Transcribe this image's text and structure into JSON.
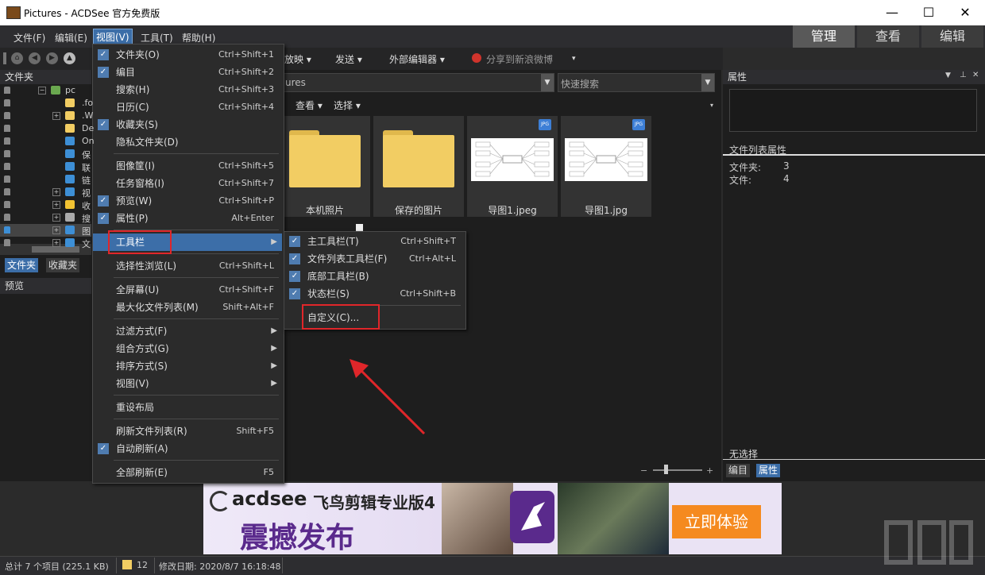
{
  "window": {
    "title": "Pictures - ACDSee 官方免费版",
    "minimize": "—",
    "maximize": "☐",
    "close": "✕"
  },
  "menubar": {
    "items": [
      "文件(F)",
      "编辑(E)",
      "视图(V)",
      "工具(T)",
      "帮助(H)"
    ],
    "modes": [
      "管理",
      "查看",
      "编辑"
    ]
  },
  "toolbar": {
    "items": [
      "放映 ▾",
      "发送 ▾",
      "外部编辑器 ▾",
      "分享到新浪微博",
      "▾"
    ]
  },
  "left_panel": {
    "header": "文件夹",
    "tree": [
      {
        "label": "pc",
        "expander": "−",
        "color": "#6aa84f"
      },
      {
        "label": ".fo",
        "expander": "",
        "color": "#f2cd63"
      },
      {
        "label": ".W",
        "expander": "+",
        "color": "#f2cd63"
      },
      {
        "label": "De",
        "expander": "",
        "color": "#f2cd63"
      },
      {
        "label": "On",
        "expander": "",
        "color": "#3d8fd6"
      },
      {
        "label": "保",
        "expander": "",
        "color": "#3d8fd6"
      },
      {
        "label": "联",
        "expander": "",
        "color": "#3d8fd6"
      },
      {
        "label": "链",
        "expander": "",
        "color": "#3d8fd6"
      },
      {
        "label": "视",
        "expander": "+",
        "color": "#3d8fd6"
      },
      {
        "label": "收",
        "expander": "+",
        "color": "#f1c232"
      },
      {
        "label": "搜",
        "expander": "+",
        "color": "#aaaaaa"
      },
      {
        "label": "图",
        "expander": "+",
        "color": "#3d8fd6"
      },
      {
        "label": "文",
        "expander": "+",
        "color": "#3d8fd6"
      }
    ],
    "tabs": [
      "文件夹",
      "收藏夹"
    ],
    "preview_header": "预览"
  },
  "center": {
    "path_value": "ures",
    "search_placeholder": "快速搜索",
    "view_label": "查看 ▾",
    "select_label": "选择 ▾",
    "tiles": [
      {
        "caption": "本机照片",
        "type": "folder"
      },
      {
        "caption": "保存的图片",
        "type": "folder"
      },
      {
        "caption": "导图1.jpeg",
        "type": "image",
        "badge": "JPG"
      },
      {
        "caption": "导图1.jpg",
        "type": "image",
        "badge": "JPG"
      }
    ]
  },
  "right_panel": {
    "header": "属性",
    "section": "文件列表属性",
    "folders_label": "文件夹:",
    "folders_value": "3",
    "files_label": "文件:",
    "files_value": "4",
    "no_selection": "无选择",
    "tabs": [
      "编目",
      "属性"
    ]
  },
  "view_menu": {
    "items": [
      {
        "label": "文件夹(O)",
        "shortcut": "Ctrl+Shift+1",
        "checked": true
      },
      {
        "label": "编目",
        "shortcut": "Ctrl+Shift+2",
        "checked": true
      },
      {
        "label": "搜索(H)",
        "shortcut": "Ctrl+Shift+3",
        "checked": false
      },
      {
        "label": "日历(C)",
        "shortcut": "Ctrl+Shift+4",
        "checked": false
      },
      {
        "label": "收藏夹(S)",
        "shortcut": "",
        "checked": true
      },
      {
        "label": "隐私文件夹(D)",
        "shortcut": "",
        "checked": false
      },
      {
        "label": "图像筐(I)",
        "shortcut": "Ctrl+Shift+5",
        "checked": false
      },
      {
        "label": "任务窗格(I)",
        "shortcut": "Ctrl+Shift+7",
        "checked": false
      },
      {
        "label": "预览(W)",
        "shortcut": "Ctrl+Shift+P",
        "checked": true
      },
      {
        "label": "属性(P)",
        "shortcut": "Alt+Enter",
        "checked": true
      },
      {
        "label": "工具栏",
        "shortcut": "",
        "checked": false,
        "submenu": true
      },
      {
        "label": "选择性浏览(L)",
        "shortcut": "Ctrl+Shift+L",
        "checked": false
      },
      {
        "label": "全屏幕(U)",
        "shortcut": "Ctrl+Shift+F",
        "checked": false
      },
      {
        "label": "最大化文件列表(M)",
        "shortcut": "Shift+Alt+F",
        "checked": false
      },
      {
        "label": "过滤方式(F)",
        "shortcut": "",
        "checked": false,
        "submenu": true
      },
      {
        "label": "组合方式(G)",
        "shortcut": "",
        "checked": false,
        "submenu": true
      },
      {
        "label": "排序方式(S)",
        "shortcut": "",
        "checked": false,
        "submenu": true
      },
      {
        "label": "视图(V)",
        "shortcut": "",
        "checked": false,
        "submenu": true
      },
      {
        "label": "重设布局",
        "shortcut": "",
        "checked": false
      },
      {
        "label": "刷新文件列表(R)",
        "shortcut": "Shift+F5",
        "checked": false
      },
      {
        "label": "自动刷新(A)",
        "shortcut": "",
        "checked": true
      },
      {
        "label": "全部刷新(E)",
        "shortcut": "F5",
        "checked": false
      }
    ]
  },
  "toolbar_submenu": {
    "items": [
      {
        "label": "主工具栏(T)",
        "shortcut": "Ctrl+Shift+T",
        "checked": true
      },
      {
        "label": "文件列表工具栏(F)",
        "shortcut": "Ctrl+Alt+L",
        "checked": true
      },
      {
        "label": "底部工具栏(B)",
        "shortcut": "",
        "checked": true
      },
      {
        "label": "状态栏(S)",
        "shortcut": "Ctrl+Shift+B",
        "checked": true
      },
      {
        "label": "自定义(C)...",
        "shortcut": "",
        "checked": false
      }
    ]
  },
  "banner": {
    "brand": "acdsee",
    "product": "飞鸟剪辑专业版4",
    "headline": "震撼发布",
    "cta": "立即体验"
  },
  "statusbar": {
    "total": "总计 7 个项目 (225.1 KB)",
    "count": "12",
    "modified": "修改日期: 2020/8/7 16:18:48"
  },
  "colors": {
    "accent": "#3c6ea8",
    "highlight_box": "#e0262a",
    "folder": "#f2cd63",
    "check": "#4f7cb0"
  }
}
